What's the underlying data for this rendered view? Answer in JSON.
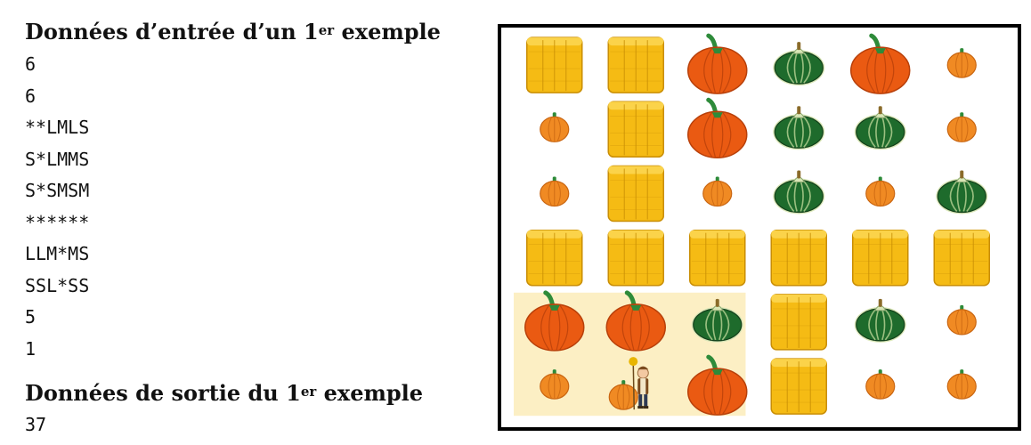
{
  "input_heading": {
    "prefix": "Données d’entrée d’un 1",
    "sup": "er",
    "suffix": " exemple"
  },
  "input_lines": [
    "6",
    "6",
    "**LMLS",
    "S*LMMS",
    "S*SMSM",
    "******",
    "LLM*MS",
    "SSL*SS",
    "5",
    "1"
  ],
  "output_heading": {
    "prefix": "Données de sortie du 1",
    "sup": "er",
    "suffix": " exemple"
  },
  "output_value": "37",
  "grid": {
    "rows": [
      [
        "hay",
        "hay",
        "pumpkin-large",
        "squash",
        "pumpkin-large",
        "pumpkin-small"
      ],
      [
        "pumpkin-small",
        "hay",
        "pumpkin-large",
        "squash",
        "squash",
        "pumpkin-small"
      ],
      [
        "pumpkin-small",
        "hay",
        "pumpkin-small",
        "squash",
        "pumpkin-small",
        "squash"
      ],
      [
        "hay",
        "hay",
        "hay",
        "hay",
        "hay",
        "hay"
      ],
      [
        "pumpkin-large",
        "pumpkin-large",
        "squash",
        "hay",
        "squash",
        "pumpkin-small"
      ],
      [
        "pumpkin-small",
        "farmer",
        "pumpkin-large",
        "hay",
        "pumpkin-small",
        "pumpkin-small"
      ]
    ],
    "highlight": {
      "row": 4,
      "col": 0,
      "rows": 2,
      "cols": 3,
      "color": "#fcefc4"
    }
  },
  "colors": {
    "hay": "#f5bb14",
    "hay_dark": "#c98e05",
    "pumpkin": "#ea5a12",
    "pumpkin_dark": "#b8400a",
    "pumpkin_small": "#f08a23",
    "squash": "#1e6b2c",
    "squash_light": "#d9e6b7",
    "stem": "#2e8b3a"
  }
}
